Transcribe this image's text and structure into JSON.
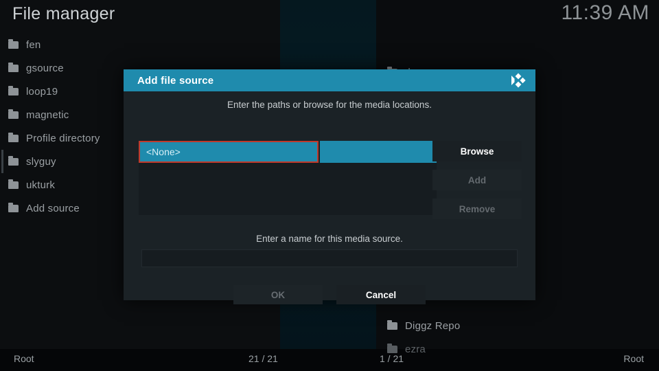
{
  "window": {
    "title": "File manager",
    "clock": "11:39 AM"
  },
  "colors": {
    "accent": "#1f8bad",
    "highlight_border": "#c0392b",
    "dialog_bg": "#1b2226",
    "text": "#9ba0a4"
  },
  "left_panel": {
    "items": [
      {
        "label": "fen",
        "icon": "folder-icon"
      },
      {
        "label": "gsource",
        "icon": "folder-icon"
      },
      {
        "label": "loop19",
        "icon": "folder-icon"
      },
      {
        "label": "magnetic",
        "icon": "folder-icon"
      },
      {
        "label": "Profile directory",
        "icon": "folder-icon"
      },
      {
        "label": "slyguy",
        "icon": "folder-icon"
      },
      {
        "label": "ukturk",
        "icon": "folder-icon"
      },
      {
        "label": "Add source",
        "icon": "folder-icon"
      }
    ]
  },
  "right_panel": {
    "items": [
      {
        "label": ".home",
        "icon": "folder-icon"
      },
      {
        "label": "Diggz Repo",
        "icon": "folder-icon"
      },
      {
        "label": "ezra",
        "icon": "folder-icon"
      }
    ]
  },
  "statusbar": {
    "left_path": "Root",
    "left_count": "21 / 21",
    "right_count": "1 / 21",
    "right_path": "Root"
  },
  "dialog": {
    "title": "Add file source",
    "logo_icon": "kodi-logo-icon",
    "subtitle_paths": "Enter the paths or browse for the media locations.",
    "subtitle_name": "Enter a name for this media source.",
    "path_value": "<None>",
    "name_value": "",
    "buttons": {
      "browse": "Browse",
      "add": "Add",
      "remove": "Remove",
      "ok": "OK",
      "cancel": "Cancel"
    }
  }
}
